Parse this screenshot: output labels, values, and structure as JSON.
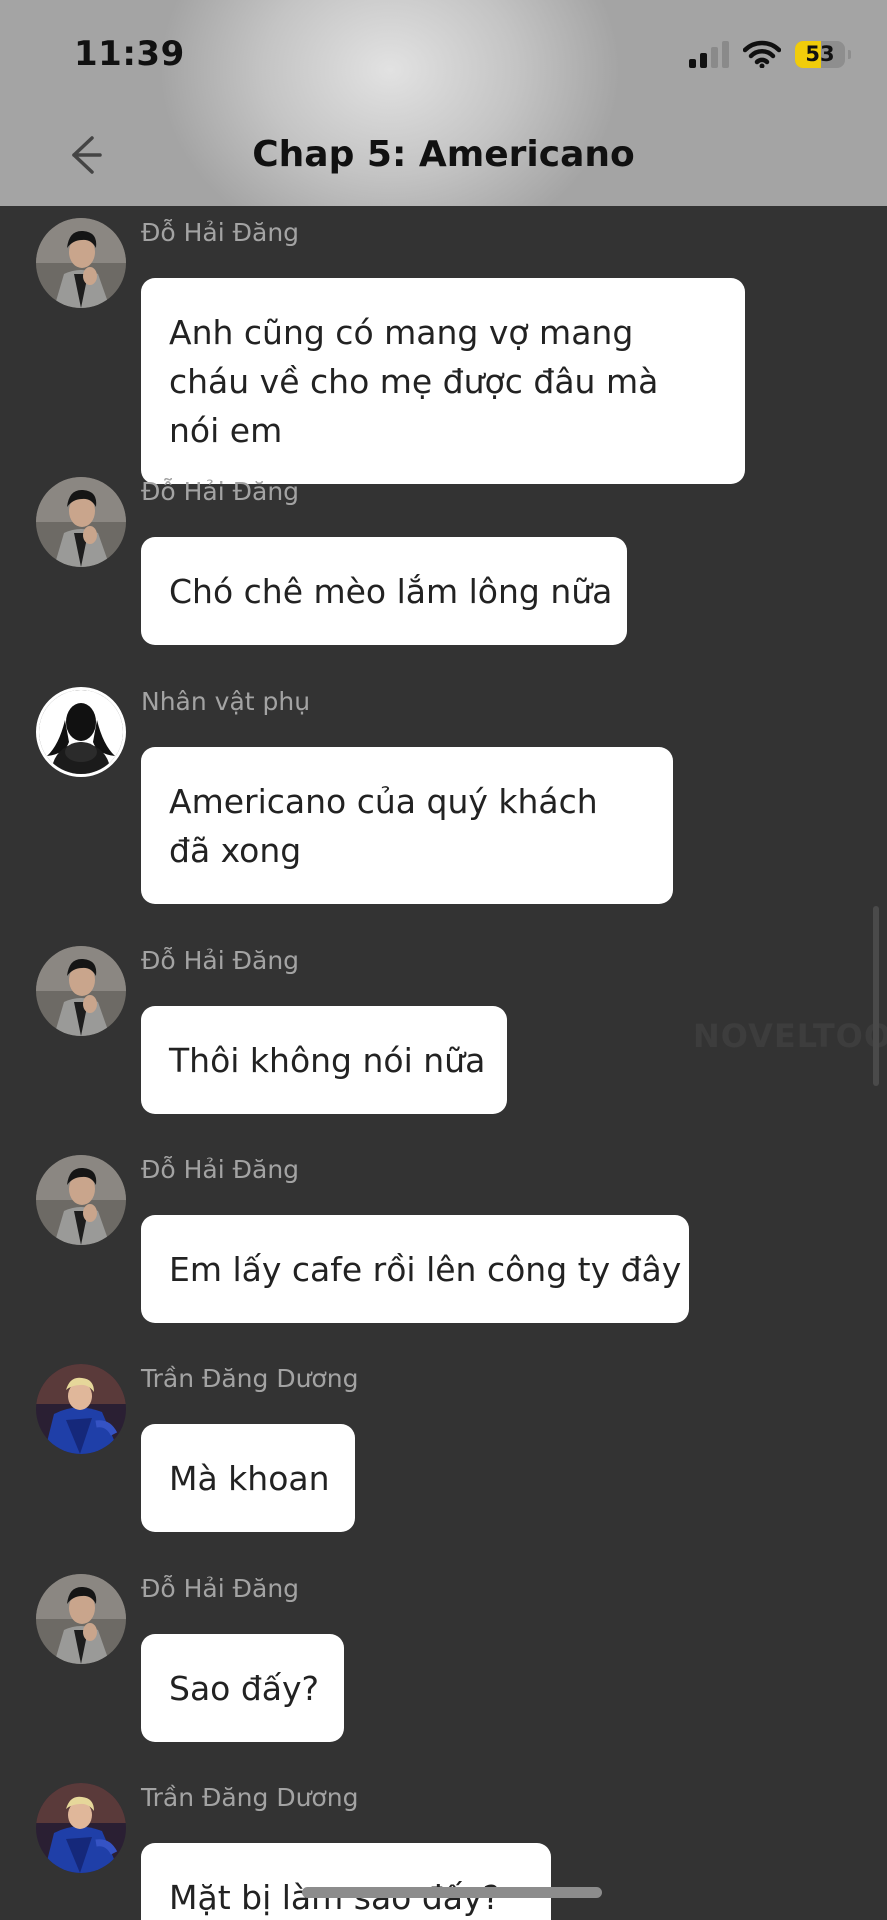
{
  "status_bar": {
    "time": "11:39",
    "battery": "53",
    "battery_level_percent": 53,
    "signal_bars_active": 2,
    "colors": {
      "battery_fill": "#f1cc0a"
    }
  },
  "header": {
    "title": "Chap 5: Americano",
    "back_icon": "arrow-left-icon"
  },
  "watermark": "NOVELTOON",
  "messages": [
    {
      "sender": "Đỗ Hải Đăng",
      "text": "Anh cũng có mang vợ mang cháu về cho mẹ được đâu mà nói em",
      "avatar": "man-gray-jacket-avatar"
    },
    {
      "sender": "Đỗ Hải Đăng",
      "text": "Chó chê mèo lắm lông nữa",
      "avatar": "man-gray-jacket-avatar"
    },
    {
      "sender": "Nhân vật phụ",
      "text": "Americano của quý khách đã xong",
      "avatar": "silhouette-avatar"
    },
    {
      "sender": "Đỗ Hải Đăng",
      "text": "Thôi không nói nữa",
      "avatar": "man-gray-jacket-avatar"
    },
    {
      "sender": "Đỗ Hải Đăng",
      "text": "Em lấy cafe rồi lên công ty đây",
      "avatar": "man-gray-jacket-avatar"
    },
    {
      "sender": "Trần Đăng Dương",
      "text": "Mà khoan",
      "avatar": "man-blue-jacket-avatar"
    },
    {
      "sender": "Đỗ Hải Đăng",
      "text": "Sao đấy?",
      "avatar": "man-gray-jacket-avatar"
    },
    {
      "sender": "Trần Đăng Dương",
      "text": "Mặt bị làm sao đấy?",
      "avatar": "man-blue-jacket-avatar"
    }
  ]
}
